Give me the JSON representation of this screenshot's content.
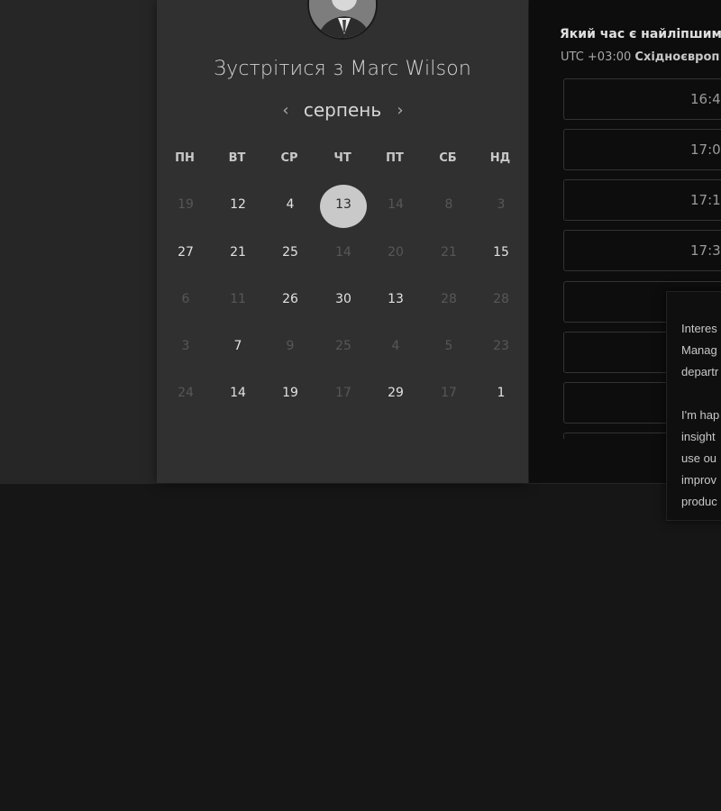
{
  "booking": {
    "title": "Зустрітися з Marc Wilson",
    "month": "серпень",
    "prev_icon": "‹",
    "next_icon": "›",
    "weekdays": [
      "ПН",
      "ВТ",
      "СР",
      "ЧТ",
      "ПТ",
      "СБ",
      "НД"
    ],
    "weeks": [
      [
        {
          "d": "19",
          "active": false
        },
        {
          "d": "12",
          "active": true
        },
        {
          "d": "4",
          "active": true
        },
        {
          "d": "13",
          "active": true,
          "selected": true
        },
        {
          "d": "14",
          "active": false
        },
        {
          "d": "8",
          "active": false
        },
        {
          "d": "3",
          "active": false
        }
      ],
      [
        {
          "d": "27",
          "active": true
        },
        {
          "d": "21",
          "active": true
        },
        {
          "d": "25",
          "active": true
        },
        {
          "d": "14",
          "active": false
        },
        {
          "d": "20",
          "active": false
        },
        {
          "d": "21",
          "active": false
        },
        {
          "d": "15",
          "active": true
        }
      ],
      [
        {
          "d": "6",
          "active": false
        },
        {
          "d": "11",
          "active": false
        },
        {
          "d": "26",
          "active": true
        },
        {
          "d": "30",
          "active": true
        },
        {
          "d": "13",
          "active": true
        },
        {
          "d": "28",
          "active": false
        },
        {
          "d": "28",
          "active": false
        }
      ],
      [
        {
          "d": "3",
          "active": false
        },
        {
          "d": "7",
          "active": true
        },
        {
          "d": "9",
          "active": false
        },
        {
          "d": "25",
          "active": false
        },
        {
          "d": "4",
          "active": false
        },
        {
          "d": "5",
          "active": false
        },
        {
          "d": "23",
          "active": false
        }
      ],
      [
        {
          "d": "24",
          "active": false
        },
        {
          "d": "14",
          "active": true
        },
        {
          "d": "19",
          "active": true
        },
        {
          "d": "17",
          "active": false
        },
        {
          "d": "29",
          "active": true
        },
        {
          "d": "17",
          "active": false
        },
        {
          "d": "1",
          "active": true
        }
      ]
    ]
  },
  "times": {
    "question": "Який час є найліпшим",
    "timezone_offset": "UTC +03:00",
    "timezone_name": "Східноєвроп",
    "slots": [
      "16:4",
      "17:0",
      "17:1",
      "17:3",
      "",
      "",
      "",
      ""
    ]
  },
  "tooltip": {
    "text": "Interes\nManag\ndepartr\n\nI'm hap\ninsight\nuse ou\nimprov\nproduc"
  },
  "colors": {
    "page_bg": "#161616",
    "card_bg": "#303030",
    "times_bg": "#0d0d0d",
    "selected_day": "#c9c9c9"
  }
}
